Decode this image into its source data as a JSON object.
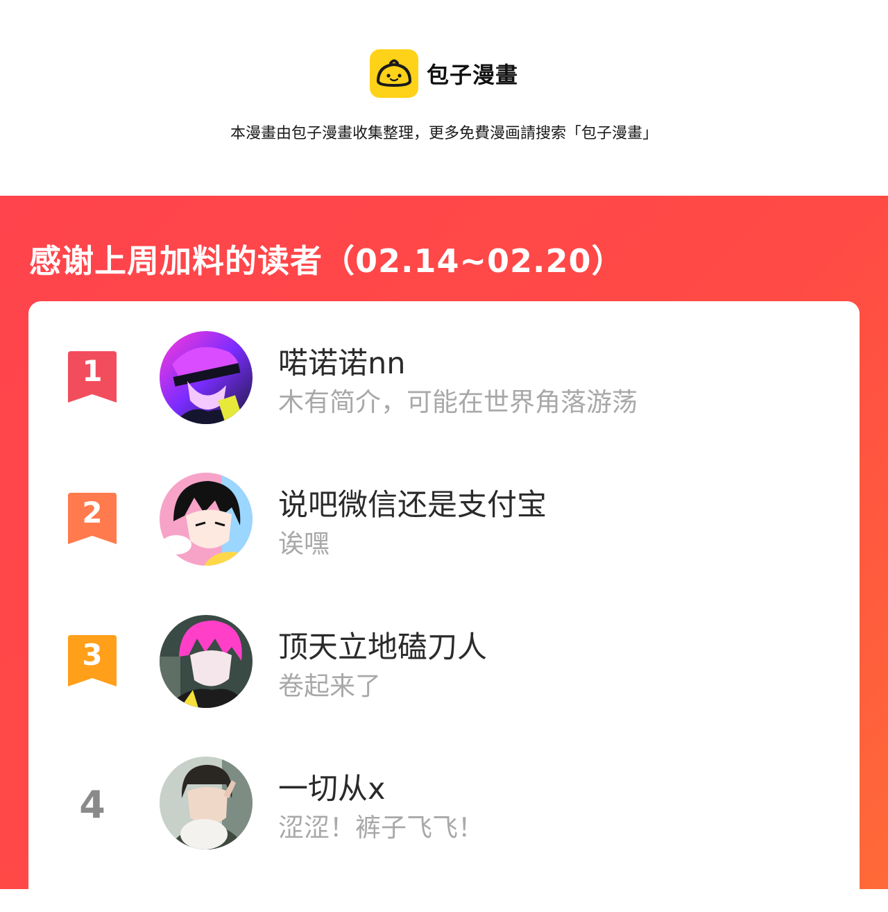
{
  "header": {
    "brand_name": "包子漫畫",
    "logo_icon": "steamed-bun-icon",
    "logo_color": "#ffd21a",
    "notice": "本漫畫由包子漫畫收集整理，更多免費漫画請搜索「包子漫畫」"
  },
  "panel": {
    "title": "感谢上周加料的读者（02.14~02.20）",
    "background_color": "#ff444d"
  },
  "readers": [
    {
      "rank": "1",
      "rank_color": "#f24d5c",
      "name": "喏诺诺nn",
      "bio": "木有简介，可能在世界角落游荡"
    },
    {
      "rank": "2",
      "rank_color": "#ff7a4d",
      "name": "说吧微信还是支付宝",
      "bio": "诶嘿"
    },
    {
      "rank": "3",
      "rank_color": "#ff9f1a",
      "name": "顶天立地磕刀人",
      "bio": "卷起来了"
    },
    {
      "rank": "4",
      "rank_color": "#8a8a8a",
      "name": "一切从x",
      "bio": "涩涩！裤子飞飞！"
    }
  ]
}
